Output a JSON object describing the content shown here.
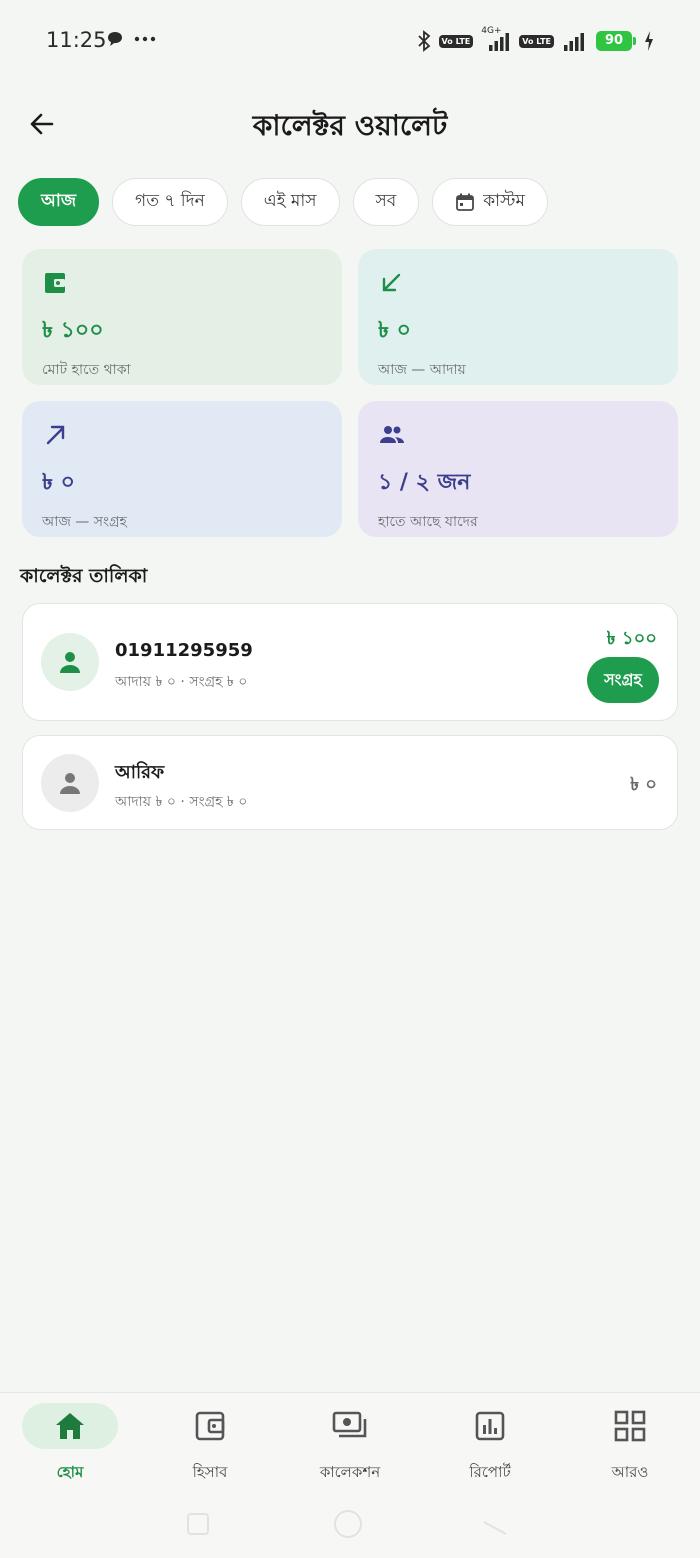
{
  "status_bar": {
    "time": "11:25",
    "network_type": "4G+",
    "lte_badge": "Vo LTE",
    "battery": "90"
  },
  "header": {
    "title": "কালেক্টর ওয়ালেট"
  },
  "filters": [
    {
      "label": "আজ",
      "active": true
    },
    {
      "label": "গত ৭ দিন",
      "active": false
    },
    {
      "label": "এই মাস",
      "active": false
    },
    {
      "label": "সব",
      "active": false
    },
    {
      "label": "কাস্টম",
      "active": false,
      "icon": "calendar-icon"
    }
  ],
  "stats": [
    {
      "icon": "wallet-icon",
      "value": "৳ ১০০",
      "label": "মোট হাতে থাকা"
    },
    {
      "icon": "arrow-down-left-icon",
      "value": "৳ ০",
      "label": "আজ — আদায়"
    },
    {
      "icon": "arrow-up-right-icon",
      "value": "৳ ০",
      "label": "আজ — সংগ্রহ"
    },
    {
      "icon": "people-icon",
      "value": "১ / ২ জন",
      "label": "হাতে আছে যাদের"
    }
  ],
  "colors": {
    "primary": "#1f9d4e",
    "card_green": "#e4efe6",
    "card_teal": "#dff0ef",
    "card_blue": "#e1e9f5",
    "card_purple": "#e9e4f4",
    "indigo": "#3c3f8d"
  },
  "section": {
    "title": "কালেক্টর তালিকা"
  },
  "collectors": [
    {
      "name": "01911295959",
      "sub": "আদায় ৳ ০ · সংগ্রহ ৳ ০",
      "amount": "৳ ১০০",
      "action": "সংগ্রহ"
    },
    {
      "name": "আরিফ",
      "sub": "আদায় ৳ ০ · সংগ্রহ ৳ ০",
      "amount": "৳ ০"
    }
  ],
  "nav": [
    {
      "label": "হোম",
      "icon": "home-icon",
      "active": true
    },
    {
      "label": "হিসাব",
      "icon": "wallet-icon",
      "active": false
    },
    {
      "label": "কালেকশন",
      "icon": "cash-icon",
      "active": false
    },
    {
      "label": "রিপোর্ট",
      "icon": "bar-chart-icon",
      "active": false
    },
    {
      "label": "আরও",
      "icon": "grid-icon",
      "active": false
    }
  ]
}
